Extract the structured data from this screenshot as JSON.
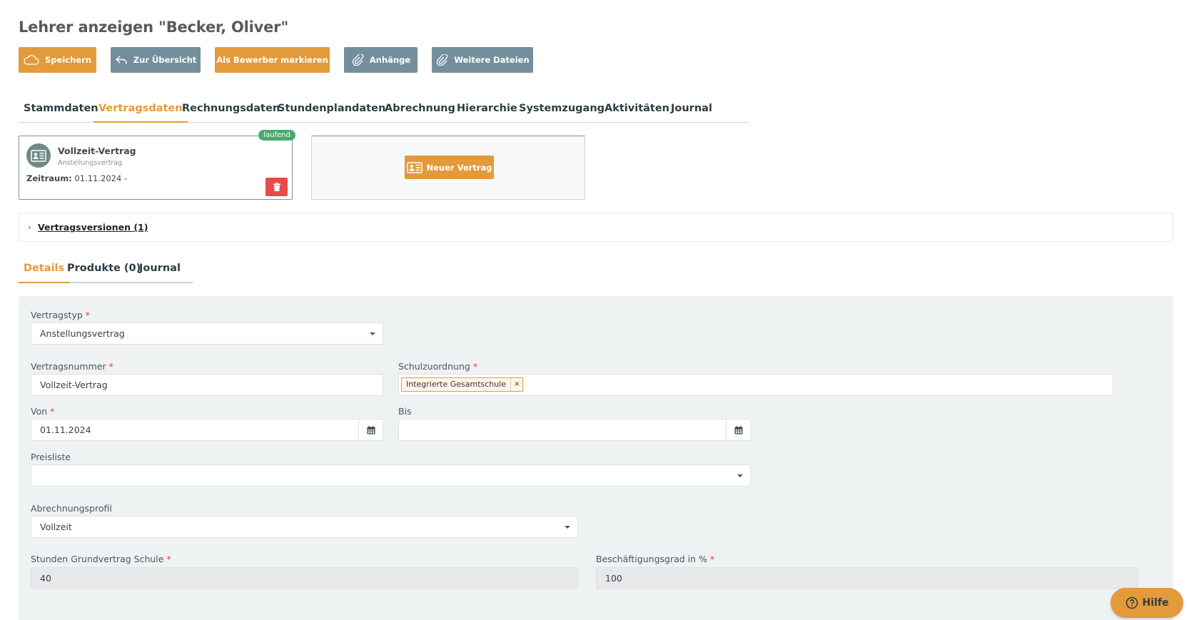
{
  "page": {
    "title": "Lehrer anzeigen \"Becker, Oliver\""
  },
  "toolbar": {
    "save": "Speichern",
    "overview": "Zur Übersicht",
    "mark_applicant": "Als Bewerber markieren",
    "attachments": "Anhänge",
    "more_files": "Weitere Dateien"
  },
  "main_tabs": [
    {
      "label": "Stammdaten"
    },
    {
      "label": "Vertragsdaten",
      "active": true
    },
    {
      "label": "Rechnungsdaten"
    },
    {
      "label": "Stundenplandaten"
    },
    {
      "label": "Abrechnung"
    },
    {
      "label": "Hierarchie"
    },
    {
      "label": "Systemzugang"
    },
    {
      "label": "Aktivitäten"
    },
    {
      "label": "Journal"
    }
  ],
  "contract": {
    "title": "Vollzeit-Vertrag",
    "subtitle": "Anstellungsvertrag",
    "range_label": "Zeitraum:",
    "range_value": "01.11.2024 -",
    "status": "laufend"
  },
  "new_contract": {
    "label": "Neuer Vertrag"
  },
  "versions": {
    "link": "Vertragsversionen (1)"
  },
  "sub_tabs": [
    {
      "label": "Details",
      "active": true
    },
    {
      "label": "Produkte (0)"
    },
    {
      "label": "Journal"
    }
  ],
  "form": {
    "contract_type": {
      "label": "Vertragstyp",
      "value": "Anstellungsvertrag"
    },
    "contract_number": {
      "label": "Vertragsnummer",
      "value": "Vollzeit-Vertrag"
    },
    "school_assignment": {
      "label": "Schulzuordnung",
      "tags": [
        "Integrierte Gesamtschule"
      ],
      "remove": "×"
    },
    "from": {
      "label": "Von",
      "value": "01.11.2024"
    },
    "to": {
      "label": "Bis",
      "value": ""
    },
    "price_list": {
      "label": "Preisliste",
      "value": ""
    },
    "billing_profile": {
      "label": "Abrechnungsprofil",
      "value": "Vollzeit"
    },
    "base_hours": {
      "label": "Stunden Grundvertrag Schule",
      "value": "40"
    },
    "employment_level": {
      "label": "Beschäftigungsgrad in %",
      "value": "100"
    },
    "required_mark": "*"
  },
  "help": {
    "label": "Hilfe"
  },
  "colors": {
    "accent": "#e39a3b",
    "secondary": "#748f9c",
    "danger": "#e84b4b",
    "success": "#4aa970"
  }
}
